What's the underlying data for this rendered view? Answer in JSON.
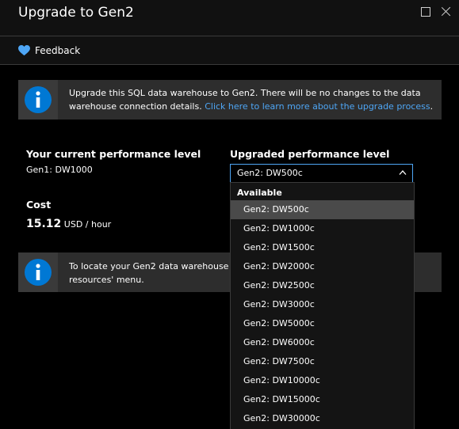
{
  "header": {
    "title": "Upgrade to Gen2"
  },
  "toolbar": {
    "feedback_label": "Feedback"
  },
  "banner_top": {
    "text": "Upgrade this SQL data warehouse to Gen2. There will be no changes to the data warehouse connection details. ",
    "link": "Click here to learn more about the upgrade process",
    "suffix": "."
  },
  "current": {
    "label": "Your current performance level",
    "value": "Gen1: DW1000"
  },
  "upgraded": {
    "label": "Upgraded performance level",
    "selected": "Gen2: DW500c"
  },
  "cost": {
    "label": "Cost",
    "amount": "15.12",
    "unit": "USD / hour"
  },
  "banner_bottom": {
    "text": "To locate your Gen2 data warehouse a resources' menu."
  },
  "dropdown": {
    "group_label": "Available",
    "options": [
      "Gen2: DW500c",
      "Gen2: DW1000c",
      "Gen2: DW1500c",
      "Gen2: DW2000c",
      "Gen2: DW2500c",
      "Gen2: DW3000c",
      "Gen2: DW5000c",
      "Gen2: DW6000c",
      "Gen2: DW7500c",
      "Gen2: DW10000c",
      "Gen2: DW15000c",
      "Gen2: DW30000c"
    ]
  },
  "colors": {
    "accent": "#4ea6f5",
    "info_icon": "#0078d4",
    "panel": "#2d2d2d"
  },
  "icons": {
    "feedback": "heart-icon",
    "info": "info-icon",
    "maximize": "maximize-icon",
    "close": "close-icon",
    "chevron": "chevron-up-icon"
  }
}
